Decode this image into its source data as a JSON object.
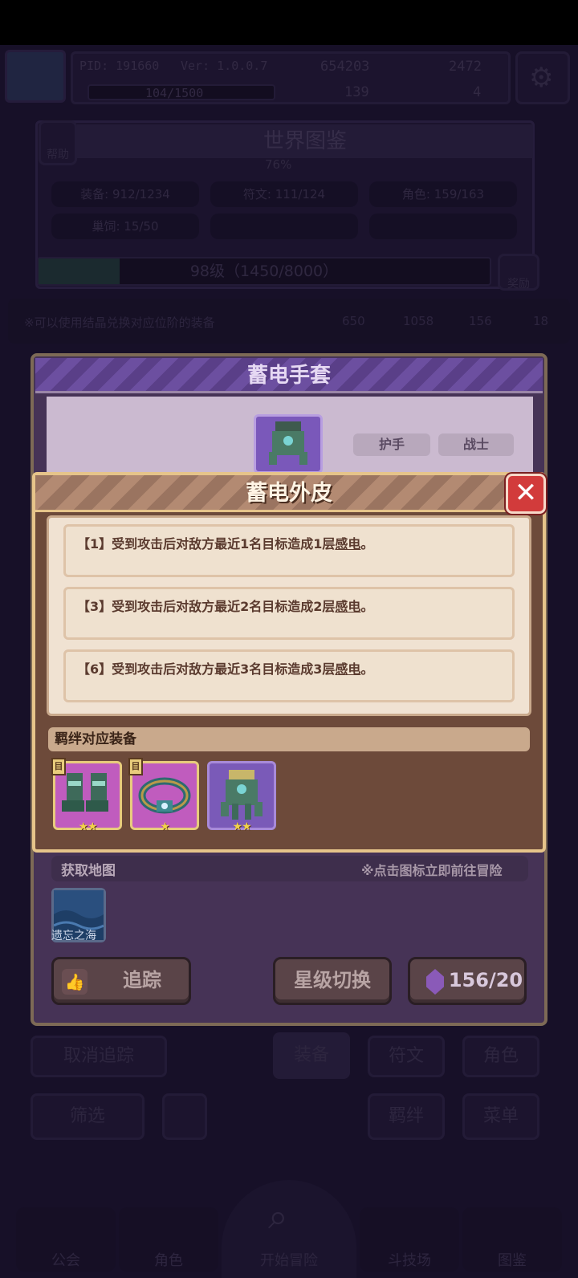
{
  "header": {
    "pid": "PID: 191660",
    "version": "Ver: 1.0.0.7",
    "gold": "654203",
    "gems": "2472",
    "exp": "104/1500",
    "clover": "139",
    "keys": "4"
  },
  "world": {
    "help_label": "帮助",
    "title": "世界图鉴",
    "percent": "76%",
    "stats": [
      "装备: 912/1234",
      "符文: 111/124",
      "角色: 159/163",
      "巢饲: 15/50"
    ],
    "level": "98级（1450/8000）",
    "reward_label": "奖励"
  },
  "exchange": {
    "hint": "※可以使用结晶兑换对应位阶的装备",
    "counts": [
      "650",
      "1058",
      "156",
      "18"
    ]
  },
  "item": {
    "title": "蓄电手套",
    "tags": [
      "护手",
      "战士"
    ]
  },
  "popup": {
    "title": "蓄电外皮",
    "close": "✕",
    "effects": [
      {
        "prefix": "【1】受到攻击后对敌方最近1名目标造成1层",
        "keyword": "感电",
        "suffix": "。"
      },
      {
        "prefix": "【3】受到攻击后对敌方最近2名目标造成2层",
        "keyword": "感电",
        "suffix": "。"
      },
      {
        "prefix": "【6】受到攻击后对敌方最近3名目标造成3层",
        "keyword": "感电",
        "suffix": "。"
      }
    ],
    "bond_label": "羁绊对应装备",
    "equipment": [
      {
        "icon": "boots-icon",
        "stars": "★★",
        "badge": "目"
      },
      {
        "icon": "bracelet-icon",
        "stars": "★",
        "badge": "目"
      },
      {
        "icon": "gloves-icon",
        "stars": "★★",
        "badge": ""
      }
    ]
  },
  "map": {
    "label": "获取地图",
    "hint": "※点击图标立即前往冒险",
    "tile_name": "遗忘之海"
  },
  "actions": {
    "track": "追踪",
    "star_switch": "星级切换",
    "crystal": "156/20"
  },
  "bg_controls": {
    "cancel_track": "取消追踪",
    "tabs": [
      "装备",
      "符文",
      "角色"
    ],
    "filter": "筛选",
    "bond": "羁绊",
    "sort": "菜单"
  },
  "nav": [
    "公会",
    "角色",
    "开始冒险",
    "斗技场",
    "图鉴"
  ],
  "colors": {
    "popup_border": "#e6c48a",
    "close_red": "#d23b3b",
    "star": "#f2d24a"
  }
}
